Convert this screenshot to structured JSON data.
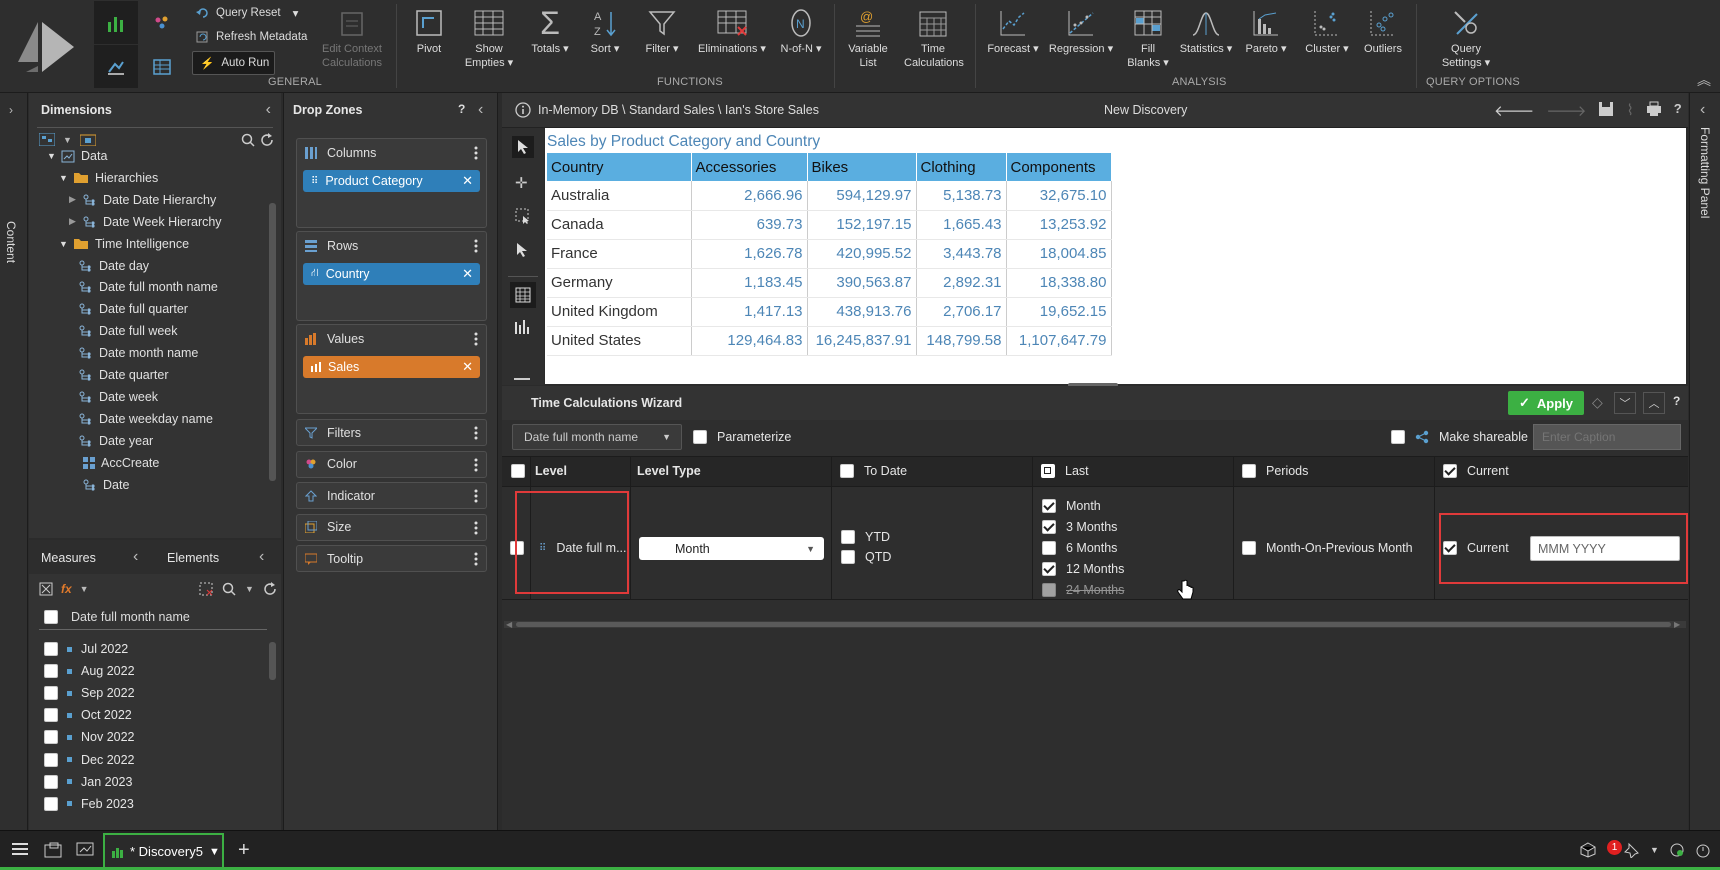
{
  "ribbon": {
    "general": {
      "query_reset": "Query Reset",
      "refresh_metadata": "Refresh Metadata",
      "auto_run": "Auto Run",
      "edit_context": "Edit Context\nCalculations",
      "group_label": "GENERAL"
    },
    "functions": {
      "items": [
        "Pivot",
        "Show\nEmpties ▾",
        "Totals ▾",
        "Sort ▾",
        "Filter ▾",
        "Eliminations ▾",
        "N-of-N ▾",
        "Variable\nList",
        "Time\nCalculations"
      ],
      "group_label": "FUNCTIONS"
    },
    "analysis": {
      "items": [
        "Forecast ▾",
        "Regression ▾",
        "Fill\nBlanks ▾",
        "Statistics ▾",
        "Pareto ▾",
        "Cluster ▾",
        "Outliers"
      ],
      "group_label": "ANALYSIS"
    },
    "query": {
      "items": [
        "Query\nSettings ▾"
      ],
      "group_label": "QUERY OPTIONS"
    }
  },
  "left_tab": "Content",
  "right_tab": "Formatting Panel",
  "dimensions": {
    "title": "Dimensions",
    "tree": [
      {
        "label": "Data",
        "level": 0,
        "kind": "data"
      },
      {
        "label": "Hierarchies",
        "level": 1,
        "kind": "folder"
      },
      {
        "label": "Date Date Hierarchy",
        "level": 2,
        "kind": "hier"
      },
      {
        "label": "Date Week Hierarchy",
        "level": 2,
        "kind": "hier"
      },
      {
        "label": "Time Intelligence",
        "level": 1,
        "kind": "folder"
      },
      {
        "label": "Date day",
        "level": 3,
        "kind": "attr"
      },
      {
        "label": "Date full month name",
        "level": 3,
        "kind": "attr"
      },
      {
        "label": "Date full quarter",
        "level": 3,
        "kind": "attr"
      },
      {
        "label": "Date full week",
        "level": 3,
        "kind": "attr"
      },
      {
        "label": "Date month name",
        "level": 3,
        "kind": "attr"
      },
      {
        "label": "Date quarter",
        "level": 3,
        "kind": "attr"
      },
      {
        "label": "Date week",
        "level": 3,
        "kind": "attr"
      },
      {
        "label": "Date weekday name",
        "level": 3,
        "kind": "attr"
      },
      {
        "label": "Date year",
        "level": 3,
        "kind": "attr"
      },
      {
        "label": "AccCreate",
        "level": 2,
        "kind": "grid"
      },
      {
        "label": "Date",
        "level": 2,
        "kind": "hier"
      }
    ]
  },
  "measures_tab": "Measures",
  "elements": {
    "tab": "Elements",
    "header": "Date full month name",
    "items": [
      "Jul 2022",
      "Aug 2022",
      "Sep 2022",
      "Oct 2022",
      "Nov 2022",
      "Dec 2022",
      "Jan 2023",
      "Feb 2023"
    ]
  },
  "drop_zones": {
    "title": "Drop Zones",
    "help": "?",
    "columns": {
      "label": "Columns",
      "chip": "Product Category"
    },
    "rows": {
      "label": "Rows",
      "chip": "Country"
    },
    "values": {
      "label": "Values",
      "chip": "Sales"
    },
    "others": [
      "Filters",
      "Color",
      "Indicator",
      "Size",
      "Tooltip"
    ]
  },
  "report": {
    "path": "In-Memory DB \\ Standard Sales \\ Ian's Store Sales",
    "name": "New Discovery",
    "table_title": "Sales by Product Category and Country",
    "headers": [
      "Country",
      "Accessories",
      "Bikes",
      "Clothing",
      "Components"
    ],
    "rows": [
      [
        "Australia",
        "2,666.96",
        "594,129.97",
        "5,138.73",
        "32,675.10"
      ],
      [
        "Canada",
        "639.73",
        "152,197.15",
        "1,665.43",
        "13,253.92"
      ],
      [
        "France",
        "1,626.78",
        "420,995.52",
        "3,443.78",
        "18,004.85"
      ],
      [
        "Germany",
        "1,183.45",
        "390,563.87",
        "2,892.31",
        "18,338.80"
      ],
      [
        "United Kingdom",
        "1,417.13",
        "438,913.76",
        "2,706.17",
        "19,652.15"
      ],
      [
        "United States",
        "129,464.83",
        "16,245,837.91",
        "148,799.58",
        "1,107,647.79"
      ]
    ]
  },
  "wizard": {
    "title": "Time Calculations Wizard",
    "apply": "Apply",
    "help": "?",
    "level_select": "Date full month name",
    "parameterize": "Parameterize",
    "make_shareable": "Make shareable",
    "caption_placeholder": "Enter Caption",
    "columns": {
      "level": "Level",
      "level_type": "Level Type",
      "to_date": "To Date",
      "last": "Last",
      "periods": "Periods",
      "current": "Current"
    },
    "row": {
      "level": "Date full m...",
      "level_type": "Month",
      "to_date": [
        {
          "label": "YTD",
          "checked": false
        },
        {
          "label": "QTD",
          "checked": false
        }
      ],
      "last": [
        {
          "label": "Month",
          "checked": true
        },
        {
          "label": "3 Months",
          "checked": true
        },
        {
          "label": "6 Months",
          "checked": false
        },
        {
          "label": "12 Months",
          "checked": true
        },
        {
          "label": "24 Months",
          "checked": false
        }
      ],
      "periods": {
        "label": "Month-On-Previous Month",
        "checked": false
      },
      "current": {
        "label": "Current",
        "checked": true,
        "format": "MMM YYYY"
      }
    }
  },
  "taskbar": {
    "tab": "* Discovery5",
    "badge": "1"
  },
  "colors": {
    "accent_green": "#3cb043",
    "chip_blue": "#2f7fb9",
    "chip_orange": "#d87a2b",
    "highlight_red": "#e03a3a",
    "table_header": "#5aaee0"
  }
}
